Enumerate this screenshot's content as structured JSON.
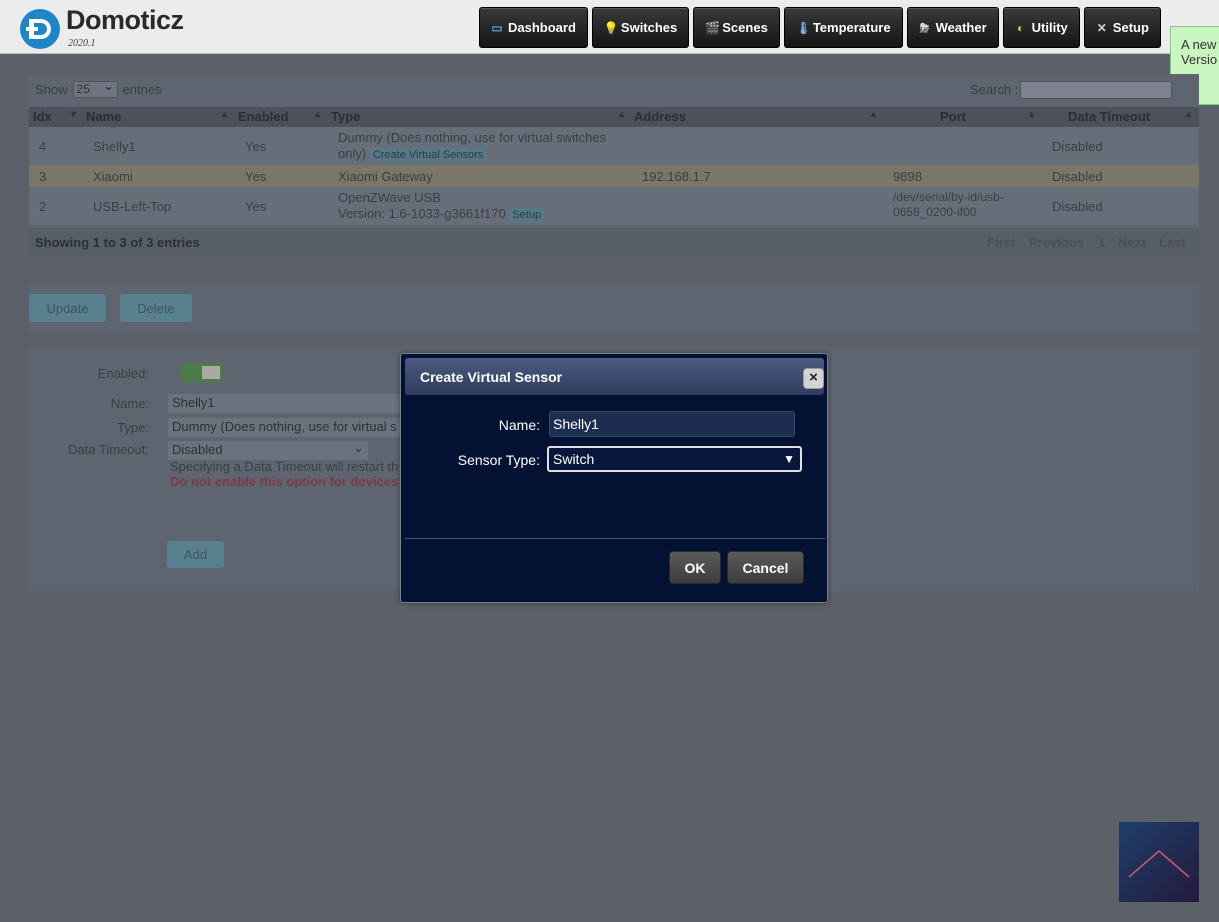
{
  "app": {
    "brand": "Domoticz",
    "version": "2020.1"
  },
  "nav": [
    {
      "label": "Dashboard",
      "icon": "monitor-icon",
      "glyph": "▭",
      "color": "#4aa3e0"
    },
    {
      "label": "Switches",
      "icon": "lightbulb-icon",
      "glyph": "💡",
      "color": "#f2d54a"
    },
    {
      "label": "Scenes",
      "icon": "clapperboard-icon",
      "glyph": "🎬",
      "color": "#6aa8e0"
    },
    {
      "label": "Temperature",
      "icon": "thermometer-icon",
      "glyph": "🌡",
      "color": "#7fb3e8"
    },
    {
      "label": "Weather",
      "icon": "cloud-rain-icon",
      "glyph": "⛈",
      "color": "#cfd6e0"
    },
    {
      "label": "Utility",
      "icon": "gauge-icon",
      "glyph": "◐",
      "color": "#e0c34a"
    },
    {
      "label": "Setup",
      "icon": "tools-icon",
      "glyph": "✕",
      "color": "#d0d0d0"
    }
  ],
  "notification": {
    "line1": "A new",
    "line2": "Versio"
  },
  "table": {
    "show_label": "Show",
    "entries_label": "entries",
    "page_size": "25",
    "search_label": "Search :",
    "columns": [
      "Idx",
      "Name",
      "Enabled",
      "Type",
      "Address",
      "Port",
      "Data Timeout"
    ],
    "rows": [
      {
        "idx": "4",
        "name": "Shelly1",
        "enabled": "Yes",
        "type_line1": "Dummy (Does nothing, use for virtual switches",
        "type_line2": "only)",
        "type_button": "Create Virtual Sensors",
        "address": "",
        "port_line1": "",
        "port_line2": "",
        "timeout": "Disabled"
      },
      {
        "idx": "3",
        "name": "Xiaomi",
        "enabled": "Yes",
        "type_line1": "Xiaomi Gateway",
        "type_line2": "",
        "type_button": "",
        "address": "192.168.1.7",
        "port_line1": "9898",
        "port_line2": "",
        "timeout": "Disabled"
      },
      {
        "idx": "2",
        "name": "USB-Left-Top",
        "enabled": "Yes",
        "type_line1": "OpenZWave USB",
        "type_line2": "Version: 1.6-1033-g3661f170",
        "type_button": "Setup",
        "address": "",
        "port_line1": "/dev/serial/by-id/usb-",
        "port_line2": "0658_0200-if00",
        "timeout": "Disabled"
      }
    ],
    "info": "Showing 1 to 3 of 3 entries",
    "pager": {
      "first": "First",
      "previous": "Previous",
      "page": "1",
      "next": "Next",
      "last": "Last"
    }
  },
  "actions": {
    "update": "Update",
    "delete": "Delete"
  },
  "form": {
    "enabled_label": "Enabled:",
    "name_label": "Name:",
    "name_value": "Shelly1",
    "type_label": "Type:",
    "type_value": "Dummy (Does nothing, use for virtual s",
    "timeout_label": "Data Timeout:",
    "timeout_value": "Disabled",
    "hint": "Specifying a Data Timeout will restart th",
    "warning": "Do not enable this option for devices",
    "add": "Add"
  },
  "modal": {
    "title": "Create Virtual Sensor",
    "close": "×",
    "name_label": "Name:",
    "name_value": "Shelly1",
    "sensor_type_label": "Sensor Type:",
    "sensor_type_value": "Switch",
    "ok": "OK",
    "cancel": "Cancel"
  }
}
